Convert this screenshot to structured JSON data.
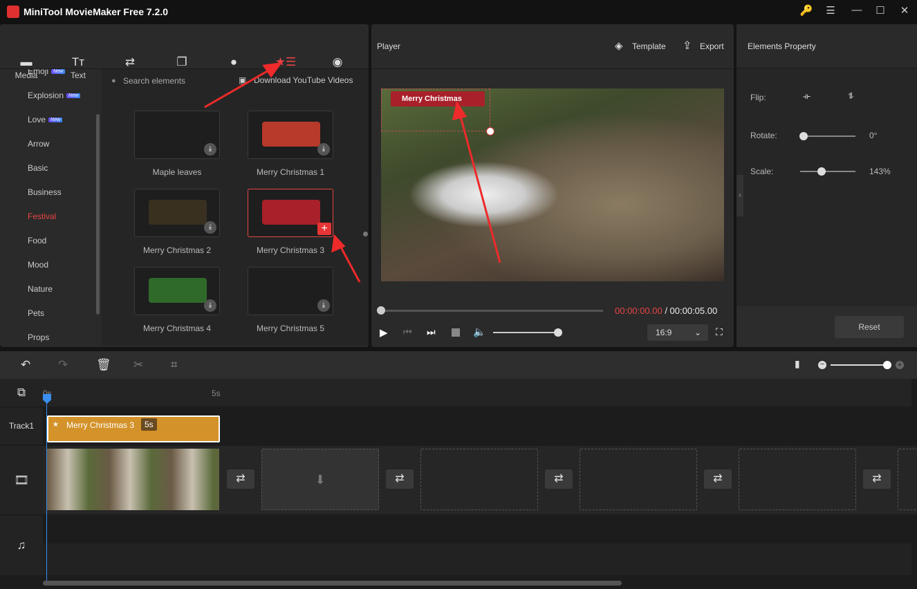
{
  "app": {
    "title": "MiniTool MovieMaker Free 7.2.0"
  },
  "window_controls": {
    "key": "🔑",
    "menu": "☰",
    "min": "—",
    "max": "☐",
    "close": "✕"
  },
  "tabs": [
    {
      "label": "Media",
      "icon": "▬"
    },
    {
      "label": "Text",
      "icon": "Tт"
    },
    {
      "label": "Transitions",
      "icon": "⇄"
    },
    {
      "label": "Effects",
      "icon": "❐"
    },
    {
      "label": "Filters",
      "icon": "●"
    },
    {
      "label": "Elements",
      "icon": "★☰",
      "active": true
    },
    {
      "label": "Motion",
      "icon": "◉"
    }
  ],
  "categories": [
    {
      "label": "Emoji",
      "new": "New"
    },
    {
      "label": "Explosion",
      "new": "New"
    },
    {
      "label": "Love",
      "new": "New"
    },
    {
      "label": "Arrow"
    },
    {
      "label": "Basic"
    },
    {
      "label": "Business"
    },
    {
      "label": "Festival",
      "active": true
    },
    {
      "label": "Food"
    },
    {
      "label": "Mood"
    },
    {
      "label": "Nature"
    },
    {
      "label": "Pets"
    },
    {
      "label": "Props"
    }
  ],
  "search": {
    "placeholder": "Search elements",
    "download": "Download YouTube Videos"
  },
  "elements": [
    {
      "label": "Maple leaves",
      "color": "#1e1e1e"
    },
    {
      "label": "Merry Christmas 1",
      "color": "#b83a2a"
    },
    {
      "label": "Merry Christmas 2",
      "color": "#3a3020"
    },
    {
      "label": "Merry Christmas 3",
      "color": "#a8202a",
      "selected": true
    },
    {
      "label": "Merry Christmas 4",
      "color": "#2f6a2a"
    },
    {
      "label": "Merry Christmas 5",
      "color": "#1e1e1e"
    }
  ],
  "player": {
    "title": "Player",
    "template": "Template",
    "export": "Export",
    "overlay_text": "Merry Christmas",
    "current_time": "00:00:00.00",
    "total_time": "/ 00:00:05.00",
    "aspect": "16:9",
    "progress": 0,
    "volume": 1.0
  },
  "properties": {
    "title": "Elements Property",
    "flip": "Flip:",
    "rotate": "Rotate:",
    "rotate_value": "0°",
    "scale": "Scale:",
    "scale_value": "143%",
    "reset": "Reset",
    "rotate_level": 0,
    "scale_level": 0.4
  },
  "timeline": {
    "ruler": [
      "0s",
      "5s"
    ],
    "track1": "Track1",
    "clip_name": "Merry Christmas 3",
    "clip_duration": "5s",
    "clip_color": "#d4922a"
  },
  "colors": {
    "accent": "#e84545"
  }
}
